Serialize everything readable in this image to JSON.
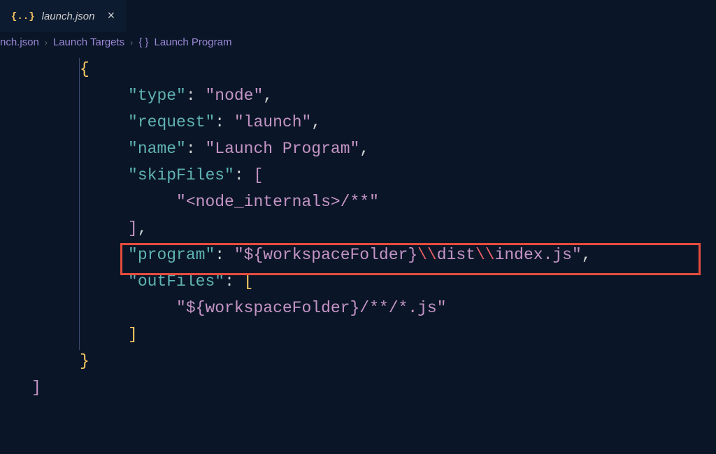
{
  "tab": {
    "icon": "{..}",
    "label": "launch.json",
    "close": "×"
  },
  "breadcrumb": {
    "item1": "nch.json",
    "item2": "Launch Targets",
    "item3_brackets": "{ }",
    "item3": "Launch Program"
  },
  "code": {
    "l1_brace": "{",
    "l2_key": "\"type\"",
    "l2_val": "\"node\"",
    "l3_key": "\"request\"",
    "l3_val": "\"launch\"",
    "l4_key": "\"name\"",
    "l4_val": "\"Launch Program\"",
    "l5_key": "\"skipFiles\"",
    "l5_bracket": "[",
    "l6_val": "\"<node_internals>/**\"",
    "l7_bracket": "]",
    "l8_key": "\"program\"",
    "l8_val_p1": "\"${workspaceFolder}",
    "l8_esc1": "\\\\",
    "l8_val_p2": "dist",
    "l8_esc2": "\\\\",
    "l8_val_p3": "index.js\"",
    "l9_key": "\"outFiles\"",
    "l9_bracket": "[",
    "l10_val": "\"${workspaceFolder}/**/*.js\"",
    "l11_bracket": "]",
    "l12_brace": "}",
    "l13_bracket": "]",
    "colon": ": ",
    "comma": ","
  }
}
